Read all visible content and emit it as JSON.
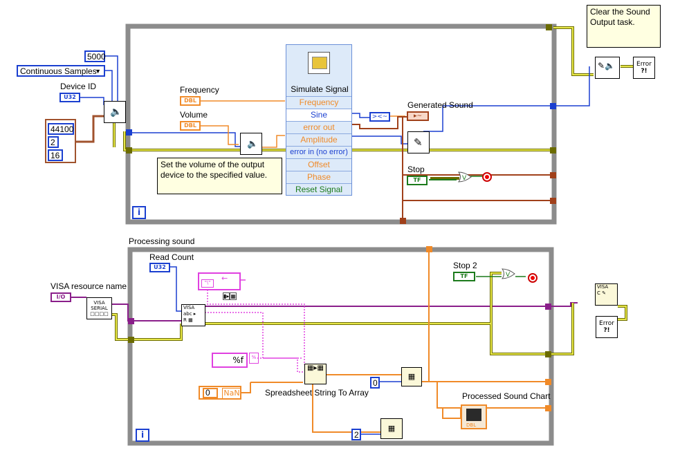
{
  "top_loop": {
    "numeric_5000": "5000",
    "sample_mode": "Continuous Samples",
    "device_id_label": "Device ID",
    "u32": "U32",
    "cluster_values": [
      "44100",
      "2",
      "16"
    ],
    "frequency_label": "Frequency",
    "volume_label": "Volume",
    "dbl": "DBL",
    "comment_volume": "Set the volume of the output device to the specified value.",
    "simulate_signal": {
      "title": "Simulate Signal",
      "rows": [
        {
          "text": "Frequency",
          "color": "orange"
        },
        {
          "text": "Sine",
          "color": "blue"
        },
        {
          "text": "error out",
          "color": "orange"
        },
        {
          "text": "Amplitude",
          "color": "orange"
        },
        {
          "text": "error in (no error)",
          "color": "blue"
        },
        {
          "text": "Offset",
          "color": "orange"
        },
        {
          "text": "Phase",
          "color": "orange"
        },
        {
          "text": "Reset Signal",
          "color": "green"
        }
      ]
    },
    "generated_sound_label": "Generated Sound",
    "stop_label": "Stop",
    "tf": "TF",
    "info": "i"
  },
  "comment_clear": "Clear the Sound Output task.",
  "bottom_loop": {
    "title": "Processing sound",
    "read_count_label": "Read Count",
    "visa_label": "VISA resource name",
    "io": "I/O",
    "stop2_label": "Stop 2",
    "format_string": "%f",
    "spreadsheet_label": "Spreadsheet String To Array",
    "const_zero_a": "0",
    "nan_text": "NaN",
    "const_zero_b": "0",
    "const_two": "2",
    "chart_label": "Processed Sound Chart",
    "info": "i",
    "error_text": "Error"
  }
}
